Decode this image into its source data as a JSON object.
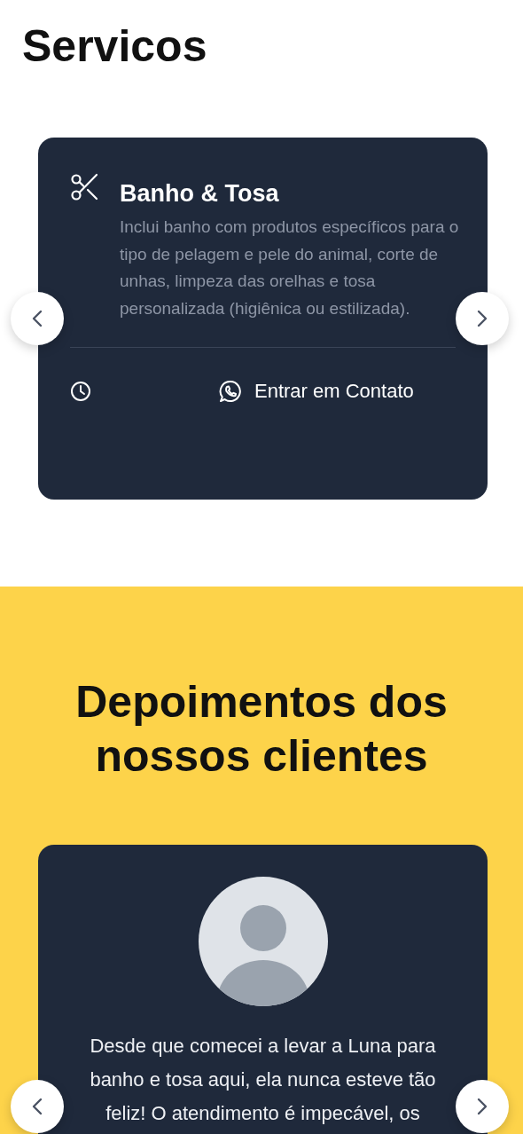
{
  "services": {
    "title": "Servicos",
    "cards": [
      {
        "title": "Banho & Tosa",
        "description": "Inclui banho com produtos específicos para o tipo de pelagem e pele do animal, corte de unhas, limpeza das orelhas e tosa personalizada (higiênica ou estilizada).",
        "contact_label": "Entrar em Contato"
      }
    ]
  },
  "testimonials": {
    "title": "Depoimentos dos nossos clientes",
    "cards": [
      {
        "quote": "Desde que comecei a levar a Luna para banho e tosa aqui, ela nunca esteve tão feliz! O atendimento é impecável, os"
      }
    ]
  }
}
